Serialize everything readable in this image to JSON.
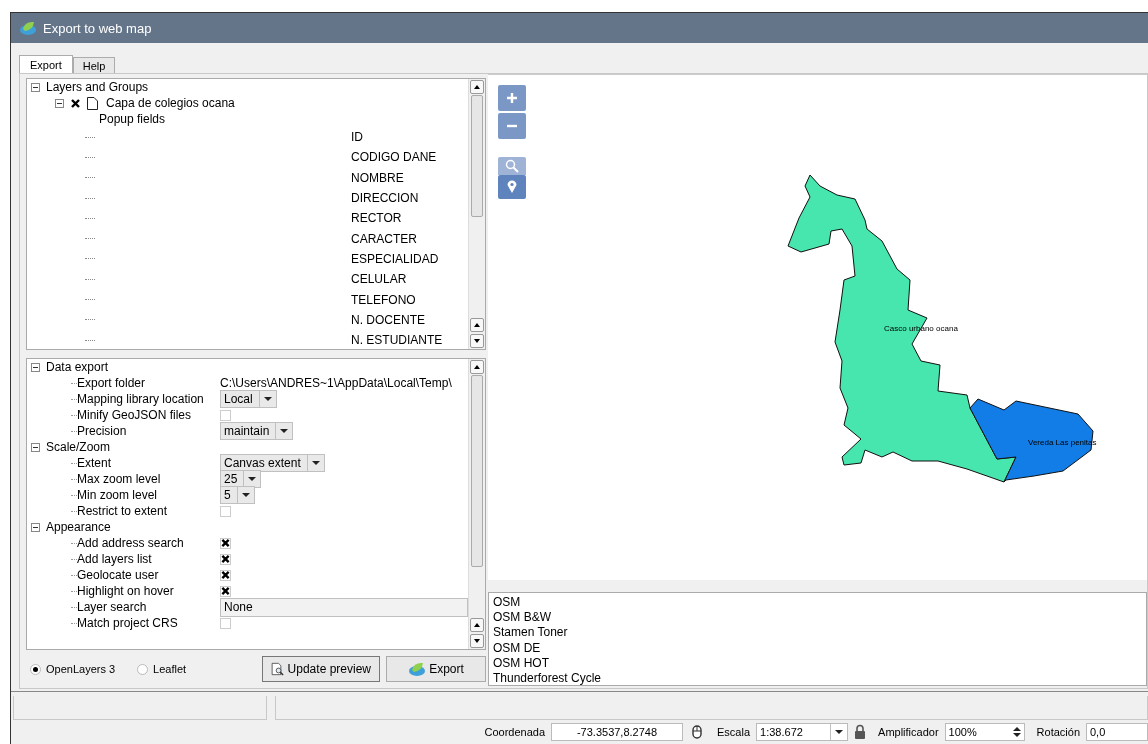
{
  "window": {
    "title": "Export to web map"
  },
  "tabs": [
    {
      "label": "Export",
      "selected": true
    },
    {
      "label": "Help",
      "selected": false
    }
  ],
  "layers_tree": {
    "label": "Layers and Groups",
    "expanded": true,
    "children": [
      {
        "label": "Capa de colegios ocana",
        "checked": true,
        "expanded": true,
        "children": [
          {
            "label": "Popup fields",
            "fields": [
              "ID",
              "CODIGO DANE",
              "NOMBRE",
              "DIRECCION",
              "RECTOR",
              "CARACTER",
              "ESPECIALIDAD",
              "CELULAR",
              "TELEFONO",
              "N. DOCENTE",
              "N. ESTUDIANTE"
            ]
          }
        ]
      }
    ]
  },
  "settings": [
    {
      "title": "Data export",
      "expanded": true,
      "items": [
        {
          "label": "Export folder",
          "kind": "text",
          "value": "C:\\Users\\ANDRES~1\\AppData\\Local\\Temp\\"
        },
        {
          "label": "Mapping library location",
          "kind": "combo",
          "value": "Local"
        },
        {
          "label": "Minify GeoJSON files",
          "kind": "checkbox",
          "checked": false
        },
        {
          "label": "Precision",
          "kind": "combo",
          "value": "maintain"
        }
      ]
    },
    {
      "title": "Scale/Zoom",
      "expanded": true,
      "items": [
        {
          "label": "Extent",
          "kind": "combo",
          "value": "Canvas extent"
        },
        {
          "label": "Max zoom level",
          "kind": "combo",
          "value": "25"
        },
        {
          "label": "Min zoom level",
          "kind": "combo",
          "value": "5"
        },
        {
          "label": "Restrict to extent",
          "kind": "checkbox",
          "checked": false
        }
      ]
    },
    {
      "title": "Appearance",
      "expanded": true,
      "items": [
        {
          "label": "Add address search",
          "kind": "checkbox",
          "checked": true
        },
        {
          "label": "Add layers list",
          "kind": "checkbox",
          "checked": true
        },
        {
          "label": "Geolocate user",
          "kind": "checkbox",
          "checked": true
        },
        {
          "label": "Highlight on hover",
          "kind": "checkbox",
          "checked": true
        },
        {
          "label": "Layer search",
          "kind": "spin",
          "value": "None"
        },
        {
          "label": "Match project CRS",
          "kind": "checkbox",
          "checked": false
        }
      ]
    }
  ],
  "renderers": [
    {
      "label": "OpenLayers 3",
      "selected": true
    },
    {
      "label": "Leaflet",
      "selected": false
    }
  ],
  "buttons": [
    {
      "label": "Update preview",
      "kind": "preview"
    },
    {
      "label": "Export",
      "kind": "export"
    }
  ],
  "map": {
    "features": [
      {
        "label": "Casco urbano ocana",
        "color": "#47e6ae"
      },
      {
        "label": "Vereda Las penitas",
        "color": "#127de6"
      }
    ]
  },
  "basemaps": [
    "OSM",
    "OSM B&W",
    "Stamen Toner",
    "OSM DE",
    "OSM HOT",
    "Thunderforest Cycle"
  ],
  "status_bar": {
    "coordinate_label": "Coordenada",
    "coordinate": "-73.3537,8.2748",
    "scale_label": "Escala",
    "scale": "1:38.672",
    "magnifier_label": "Amplificador",
    "magnifier": "100%",
    "rotation_label": "Rotación",
    "rotation": "0,0"
  }
}
